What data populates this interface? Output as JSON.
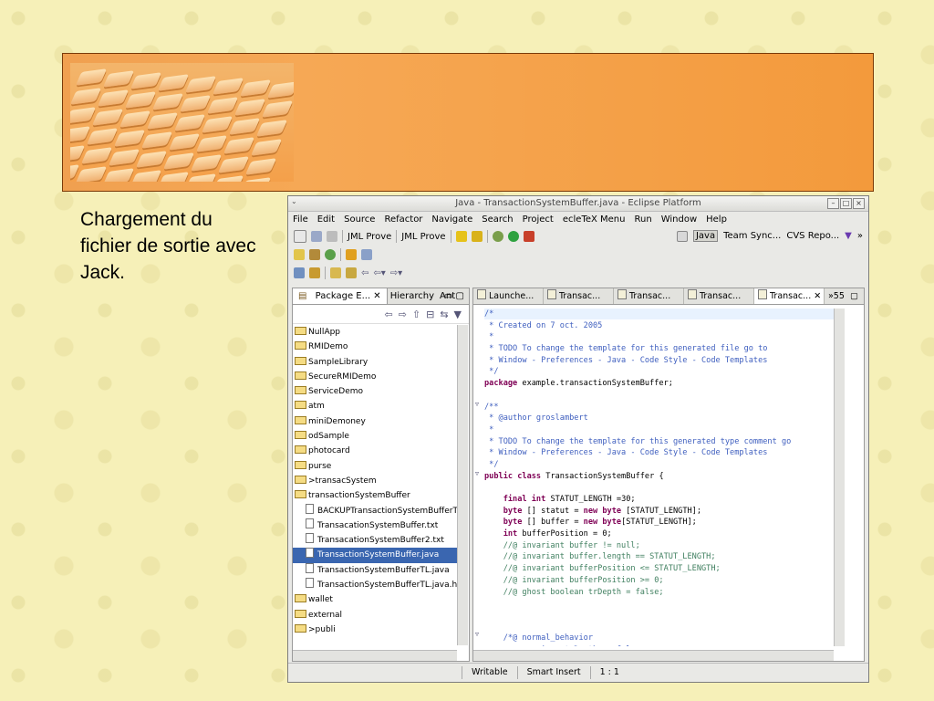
{
  "slide": {
    "caption": "Chargement du fichier de sortie avec Jack."
  },
  "window": {
    "title": "Java - TransactionSystemBuffer.java - Eclipse Platform",
    "buttons": [
      "–",
      "□",
      "×"
    ]
  },
  "menu": [
    "File",
    "Edit",
    "Source",
    "Refactor",
    "Navigate",
    "Search",
    "Project",
    "ecleTeX Menu",
    "Run",
    "Window",
    "Help"
  ],
  "toolbar": {
    "jml1": "JML Prove",
    "jml2": "JML Prove",
    "perspectives": [
      "Java",
      "Team Sync...",
      "CVS Repo..."
    ],
    "more": "»"
  },
  "package_explorer": {
    "tabs": [
      "Package E... ✕",
      "Hierarchy",
      "Ant"
    ],
    "items": [
      {
        "label": "NullApp",
        "type": "folder",
        "indent": 0
      },
      {
        "label": "RMIDemo",
        "type": "folder",
        "indent": 0
      },
      {
        "label": "SampleLibrary",
        "type": "folder",
        "indent": 0
      },
      {
        "label": "SecureRMIDemo",
        "type": "folder",
        "indent": 0
      },
      {
        "label": "ServiceDemo",
        "type": "folder",
        "indent": 0
      },
      {
        "label": "atm",
        "type": "folder",
        "indent": 0
      },
      {
        "label": "miniDemoney",
        "type": "folder",
        "indent": 0
      },
      {
        "label": "odSample",
        "type": "folder",
        "indent": 0
      },
      {
        "label": "photocard",
        "type": "folder",
        "indent": 0
      },
      {
        "label": "purse",
        "type": "folder",
        "indent": 0
      },
      {
        "label": ">transacSystem",
        "type": "folder",
        "indent": 0
      },
      {
        "label": "transactionSystemBuffer",
        "type": "folder",
        "indent": 0
      },
      {
        "label": "BACKUPTransactionSystemBufferT",
        "type": "file",
        "indent": 1
      },
      {
        "label": "TransacationSystemBuffer.txt",
        "type": "file",
        "indent": 1
      },
      {
        "label": "TransacationSystemBuffer2.txt",
        "type": "file",
        "indent": 1
      },
      {
        "label": "TransactionSystemBuffer.java",
        "type": "file",
        "indent": 1,
        "selected": true
      },
      {
        "label": "TransactionSystemBufferTL.java",
        "type": "file",
        "indent": 1
      },
      {
        "label": "TransactionSystemBufferTL.java.ht",
        "type": "file",
        "indent": 1
      },
      {
        "label": "wallet",
        "type": "folder",
        "indent": 0
      },
      {
        "label": "external",
        "type": "folder",
        "indent": 0
      },
      {
        "label": ">publi",
        "type": "folder",
        "indent": 0
      }
    ]
  },
  "editor": {
    "tabs": [
      "Launche...",
      "Transac...",
      "Transac...",
      "Transac...",
      "Transac... ✕"
    ],
    "overflow": "»55",
    "lines": [
      [
        [
          "cm",
          "/*"
        ]
      ],
      [
        [
          "cm",
          " * Created on 7 oct. 2005"
        ]
      ],
      [
        [
          "cm",
          " *"
        ]
      ],
      [
        [
          "cm",
          " * TODO To change the template for this generated file go to"
        ]
      ],
      [
        [
          "cm",
          " * Window - Preferences - Java - Code Style - Code Templates"
        ]
      ],
      [
        [
          "cm",
          " */"
        ]
      ],
      [
        [
          "kw",
          "package"
        ],
        [
          "tx",
          " example.transactionSystemBuffer;"
        ]
      ],
      [
        [
          "tx",
          ""
        ]
      ],
      [
        [
          "cm",
          "/**"
        ]
      ],
      [
        [
          "cm",
          " * @author groslambert"
        ]
      ],
      [
        [
          "cm",
          " *"
        ]
      ],
      [
        [
          "cm",
          " * TODO To change the template for this generated type comment go"
        ]
      ],
      [
        [
          "cm",
          " * Window - Preferences - Java - Code Style - Code Templates"
        ]
      ],
      [
        [
          "cm",
          " */"
        ]
      ],
      [
        [
          "kw",
          "public class"
        ],
        [
          "tx",
          " TransactionSystemBuffer {"
        ]
      ],
      [
        [
          "tx",
          ""
        ]
      ],
      [
        [
          "tx",
          "    "
        ],
        [
          "kw",
          "final int"
        ],
        [
          "tx",
          " STATUT_LENGTH =30;"
        ]
      ],
      [
        [
          "tx",
          "    "
        ],
        [
          "kw",
          "byte"
        ],
        [
          "tx",
          " [] statut = "
        ],
        [
          "kw",
          "new byte"
        ],
        [
          "tx",
          " [STATUT_LENGTH];"
        ]
      ],
      [
        [
          "tx",
          "    "
        ],
        [
          "kw",
          "byte"
        ],
        [
          "tx",
          " [] buffer = "
        ],
        [
          "kw",
          "new byte"
        ],
        [
          "tx",
          "[STATUT_LENGTH];"
        ]
      ],
      [
        [
          "tx",
          "    "
        ],
        [
          "kw",
          "int"
        ],
        [
          "tx",
          " bufferPosition = 0;"
        ]
      ],
      [
        [
          "sc",
          "    //@ invariant buffer != null;"
        ]
      ],
      [
        [
          "sc",
          "    //@ invariant buffer.length == STATUT_LENGTH;"
        ]
      ],
      [
        [
          "sc",
          "    //@ invariant bufferPosition <= STATUT_LENGTH;"
        ]
      ],
      [
        [
          "sc",
          "    //@ invariant bufferPosition >= 0;"
        ]
      ],
      [
        [
          "sc",
          "    //@ ghost boolean trDepth = false;"
        ]
      ],
      [
        [
          "tx",
          ""
        ]
      ],
      [
        [
          "tx",
          ""
        ]
      ],
      [
        [
          "tx",
          ""
        ]
      ],
      [
        [
          "cm",
          "    /*@ normal_behavior"
        ]
      ],
      [
        [
          "cm",
          "      @ requires trDepth == false;"
        ]
      ]
    ]
  },
  "status": {
    "mode": "Writable",
    "insert": "Smart Insert",
    "position": "1 : 1"
  }
}
